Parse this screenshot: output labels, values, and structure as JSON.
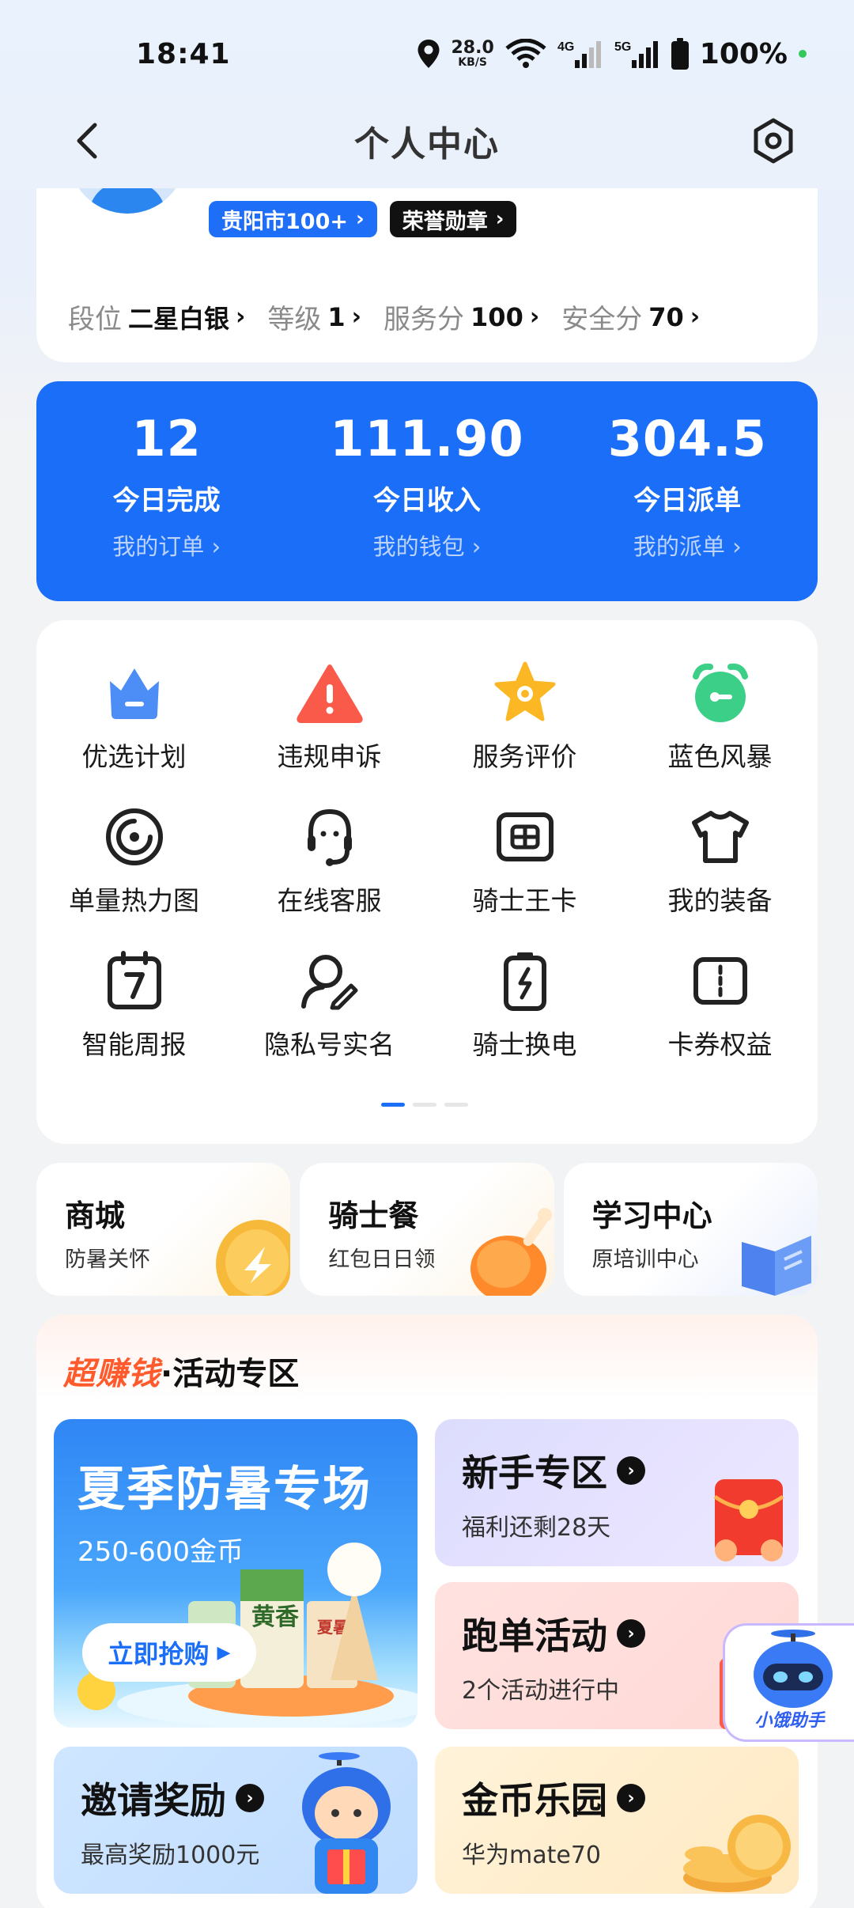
{
  "status": {
    "time": "18:41",
    "net_speed": "28.0",
    "net_unit": "KB/S",
    "net_4g": "4G",
    "net_5g": "5G",
    "battery": "100%"
  },
  "nav": {
    "title": "个人中心"
  },
  "profile": {
    "city_badge": "贵阳市100+",
    "honor_badge": "荣誉勋章",
    "stats": [
      {
        "label": "段位",
        "value": "二星白银"
      },
      {
        "label": "等级",
        "value": "1"
      },
      {
        "label": "服务分",
        "value": "100"
      },
      {
        "label": "安全分",
        "value": "70"
      }
    ]
  },
  "summary": [
    {
      "number": "12",
      "title": "今日完成",
      "link": "我的订单"
    },
    {
      "number": "111.90",
      "title": "今日收入",
      "link": "我的钱包"
    },
    {
      "number": "304.5",
      "title": "今日派单",
      "link": "我的派单"
    }
  ],
  "grid": [
    {
      "label": "优选计划",
      "icon": "crown-icon"
    },
    {
      "label": "违规申诉",
      "icon": "warning-icon"
    },
    {
      "label": "服务评价",
      "icon": "star-icon"
    },
    {
      "label": "蓝色风暴",
      "icon": "alarm-clock-icon"
    },
    {
      "label": "单量热力图",
      "icon": "target-icon"
    },
    {
      "label": "在线客服",
      "icon": "headset-icon"
    },
    {
      "label": "骑士王卡",
      "icon": "sim-card-icon"
    },
    {
      "label": "我的装备",
      "icon": "tshirt-icon"
    },
    {
      "label": "智能周报",
      "icon": "calendar-icon"
    },
    {
      "label": "隐私号实名",
      "icon": "user-edit-icon"
    },
    {
      "label": "骑士换电",
      "icon": "battery-swap-icon"
    },
    {
      "label": "卡券权益",
      "icon": "coupon-icon"
    }
  ],
  "mini_cards": [
    {
      "title": "商城",
      "sub": "防暑关怀"
    },
    {
      "title": "骑士餐",
      "sub": "红包日日领"
    },
    {
      "title": "学习中心",
      "sub": "原培训中心"
    }
  ],
  "activity": {
    "hot": "超赚钱",
    "zone": "·活动专区",
    "promo": {
      "title": "夏季防暑专场",
      "sub": "250-600金币",
      "button": "立即抢购",
      "product_text_1": "黄香",
      "product_text_2": "夏暑叶"
    },
    "tiles": [
      {
        "title": "新手专区",
        "sub": "福利还剩28天"
      },
      {
        "title": "跑单活动",
        "sub": "2个活动进行中"
      },
      {
        "title": "邀请奖励",
        "sub": "最高奖励1000元"
      },
      {
        "title": "金币乐园",
        "sub": "华为mate70"
      }
    ],
    "assistant": "小饿助手"
  },
  "colors": {
    "primary": "#1b6ef7",
    "hot": "#ff5a2c",
    "background": "#f2f3f5"
  }
}
